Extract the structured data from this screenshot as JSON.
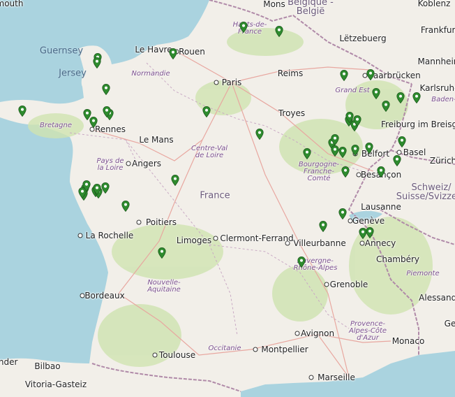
{
  "map": {
    "land_color": "#f2efe9",
    "sea_color": "#aad3df",
    "forest_color": "#cfe3b0",
    "border_color": "#b08aa8",
    "marker_color": "#2e8b2e",
    "marker_icon": "map-pin-icon"
  },
  "countries": [
    {
      "label": "Belgique / België",
      "line1": "Belgique -",
      "line2": "België"
    },
    {
      "label": "France",
      "text": "France"
    },
    {
      "label": "Schweiz/Suisse/Svizzera",
      "line1": "Schweiz/",
      "line2": "Suisse/Svizzera"
    }
  ],
  "seas": [
    {
      "name": "Guernsey",
      "text": "Guernsey"
    },
    {
      "name": "Jersey",
      "text": "Jersey"
    }
  ],
  "regions": [
    {
      "name": "Hauts-de-France",
      "text": "Hauts-de-\nFrance"
    },
    {
      "name": "Normandie",
      "text": "Normandie"
    },
    {
      "name": "Grand Est",
      "text": "Grand Est"
    },
    {
      "name": "Bretagne",
      "text": "Bretagne"
    },
    {
      "name": "Centre-Val de Loire",
      "text": "Centre-Val\nde Loire"
    },
    {
      "name": "Pays de la Loire",
      "text": "Pays de\nla Loire"
    },
    {
      "name": "Bourgogne-Franche-Comté",
      "text": "Bourgogne-\nFranche-\nComté"
    },
    {
      "name": "Nouvelle-Aquitaine",
      "text": "Nouvelle-\nAquitaine"
    },
    {
      "name": "Auvergne-Rhône-Alpes",
      "text": "Auvergne-\nRhône-Alpes"
    },
    {
      "name": "Occitanie",
      "text": "Occitanie"
    },
    {
      "name": "Provence-Alpes-Côte d'Azur",
      "text": "Provence-\nAlpes-Côte\nd'Azur"
    },
    {
      "name": "Baden-Württemberg",
      "text": "Baden-"
    },
    {
      "name": "Piemonte",
      "text": "Piemonte"
    }
  ],
  "cities": [
    "Mons",
    "Koblenz",
    "Frankfurt",
    "Mannheim",
    "Karlsruhe",
    "Saarbrücken",
    "Lëtzebuerg",
    "Reims",
    "Paris",
    "Rouen",
    "Le Havre",
    "Rennes",
    "Le Mans",
    "Angers",
    "Troyes",
    "Freiburg im Breisgau",
    "Basel",
    "Belfort",
    "Besançon",
    "Zürich",
    "Lausanne",
    "Genève",
    "Annecy",
    "Chambéry",
    "Villeurbanne",
    "Grenoble",
    "Clermont-Ferrand",
    "Limoges",
    "Poitiers",
    "La Rochelle",
    "Bordeaux",
    "Toulouse",
    "Montpellier",
    "Avignon",
    "Marseille",
    "Monaco",
    "Bilbao",
    "Vitoria-Gasteiz",
    "Alessandria",
    "mouth",
    "ander",
    "Ge"
  ],
  "markers_count": 50
}
